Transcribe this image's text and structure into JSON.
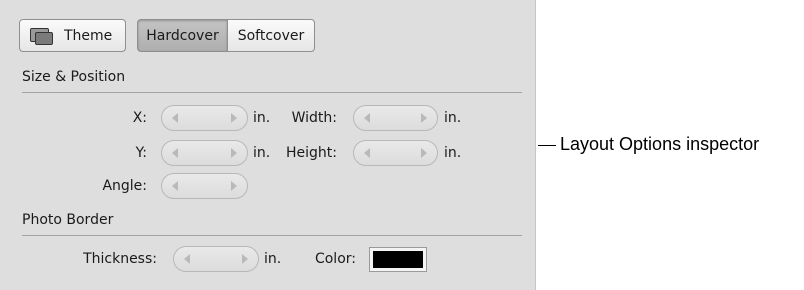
{
  "toolbar": {
    "theme_label": "Theme",
    "hardcover_label": "Hardcover",
    "softcover_label": "Softcover",
    "selected": "Hardcover"
  },
  "size_position": {
    "title": "Size & Position",
    "x_label": "X:",
    "y_label": "Y:",
    "width_label": "Width:",
    "height_label": "Height:",
    "angle_label": "Angle:",
    "unit": "in."
  },
  "photo_border": {
    "title": "Photo Border",
    "thickness_label": "Thickness:",
    "color_label": "Color:",
    "unit": "in.",
    "color_value": "#000000"
  },
  "callout": {
    "text": "Layout Options inspector"
  }
}
